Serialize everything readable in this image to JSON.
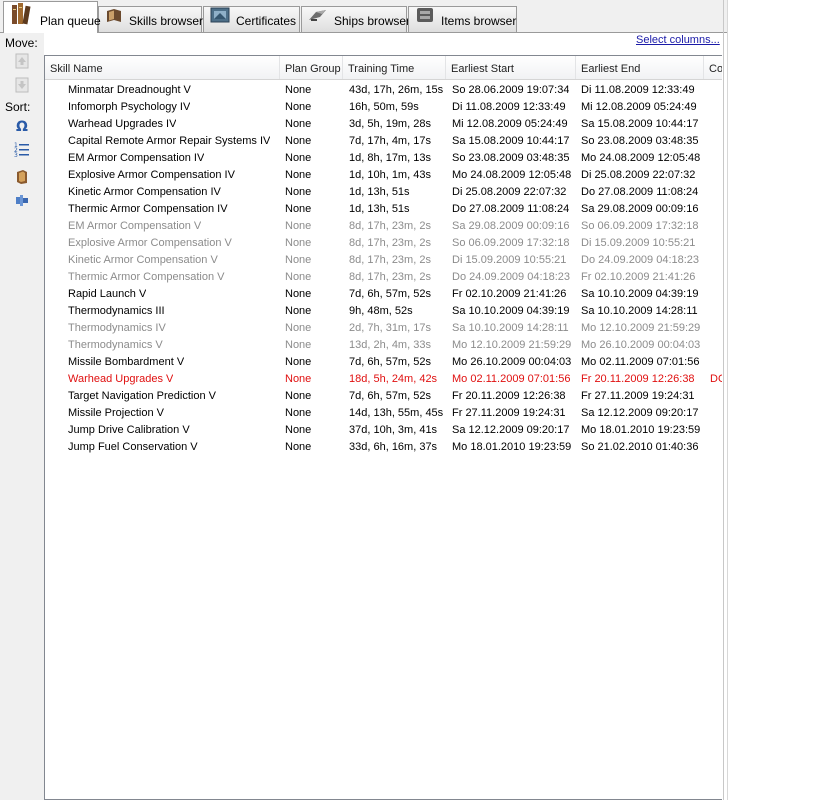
{
  "tabs": [
    {
      "label": "Plan queue",
      "icon": "books-icon",
      "active": true
    },
    {
      "label": "Skills browser",
      "icon": "book-icon",
      "active": false
    },
    {
      "label": "Certificates",
      "icon": "certificate-icon",
      "active": false
    },
    {
      "label": "Ships browser",
      "icon": "ship-icon",
      "active": false
    },
    {
      "label": "Items browser",
      "icon": "items-icon",
      "active": false
    }
  ],
  "sidebar": {
    "move_label": "Move:",
    "sort_label": "Sort:",
    "buttons": [
      "move-up-icon",
      "move-down-icon",
      "sort-alpha-icon",
      "sort-list-icon",
      "open-book-icon",
      "flag-icon"
    ]
  },
  "select_columns": "Select columns...",
  "columns": [
    "Skill Name",
    "Plan Group",
    "Training Time",
    "Earliest Start",
    "Earliest End",
    "Co"
  ],
  "rows": [
    {
      "name": "Minmatar Dreadnought V",
      "group": "None",
      "time": "43d, 17h, 26m, 15s",
      "start": "So 28.06.2009 19:07:34",
      "end": "Di 11.08.2009 12:33:49",
      "extra": "",
      "style": "normal"
    },
    {
      "name": "Infomorph Psychology IV",
      "group": "None",
      "time": "16h, 50m, 59s",
      "start": "Di 11.08.2009 12:33:49",
      "end": "Mi 12.08.2009 05:24:49",
      "extra": "",
      "style": "normal"
    },
    {
      "name": "Warhead Upgrades IV",
      "group": "None",
      "time": "3d, 5h, 19m, 28s",
      "start": "Mi 12.08.2009 05:24:49",
      "end": "Sa 15.08.2009 10:44:17",
      "extra": "",
      "style": "normal"
    },
    {
      "name": "Capital Remote Armor Repair Systems IV",
      "group": "None",
      "time": "7d, 17h, 4m, 17s",
      "start": "Sa 15.08.2009 10:44:17",
      "end": "So 23.08.2009 03:48:35",
      "extra": "",
      "style": "normal"
    },
    {
      "name": "EM Armor Compensation IV",
      "group": "None",
      "time": "1d, 8h, 17m, 13s",
      "start": "So 23.08.2009 03:48:35",
      "end": "Mo 24.08.2009 12:05:48",
      "extra": "",
      "style": "normal"
    },
    {
      "name": "Explosive Armor Compensation IV",
      "group": "None",
      "time": "1d, 10h, 1m, 43s",
      "start": "Mo 24.08.2009 12:05:48",
      "end": "Di 25.08.2009 22:07:32",
      "extra": "",
      "style": "normal"
    },
    {
      "name": "Kinetic Armor Compensation IV",
      "group": "None",
      "time": "1d, 13h, 51s",
      "start": "Di 25.08.2009 22:07:32",
      "end": "Do 27.08.2009 11:08:24",
      "extra": "",
      "style": "normal"
    },
    {
      "name": "Thermic Armor Compensation IV",
      "group": "None",
      "time": "1d, 13h, 51s",
      "start": "Do 27.08.2009 11:08:24",
      "end": "Sa 29.08.2009 00:09:16",
      "extra": "",
      "style": "normal"
    },
    {
      "name": "EM Armor Compensation V",
      "group": "None",
      "time": "8d, 17h, 23m, 2s",
      "start": "Sa 29.08.2009 00:09:16",
      "end": "So 06.09.2009 17:32:18",
      "extra": "",
      "style": "prereq"
    },
    {
      "name": "Explosive Armor Compensation V",
      "group": "None",
      "time": "8d, 17h, 23m, 2s",
      "start": "So 06.09.2009 17:32:18",
      "end": "Di 15.09.2009 10:55:21",
      "extra": "",
      "style": "prereq"
    },
    {
      "name": "Kinetic Armor Compensation V",
      "group": "None",
      "time": "8d, 17h, 23m, 2s",
      "start": "Di 15.09.2009 10:55:21",
      "end": "Do 24.09.2009 04:18:23",
      "extra": "",
      "style": "prereq"
    },
    {
      "name": "Thermic Armor Compensation V",
      "group": "None",
      "time": "8d, 17h, 23m, 2s",
      "start": "Do 24.09.2009 04:18:23",
      "end": "Fr 02.10.2009 21:41:26",
      "extra": "",
      "style": "prereq"
    },
    {
      "name": "Rapid Launch V",
      "group": "None",
      "time": "7d, 6h, 57m, 52s",
      "start": "Fr 02.10.2009 21:41:26",
      "end": "Sa 10.10.2009 04:39:19",
      "extra": "",
      "style": "normal"
    },
    {
      "name": "Thermodynamics III",
      "group": "None",
      "time": "9h, 48m, 52s",
      "start": "Sa 10.10.2009 04:39:19",
      "end": "Sa 10.10.2009 14:28:11",
      "extra": "",
      "style": "normal"
    },
    {
      "name": "Thermodynamics IV",
      "group": "None",
      "time": "2d, 7h, 31m, 17s",
      "start": "Sa 10.10.2009 14:28:11",
      "end": "Mo 12.10.2009 21:59:29",
      "extra": "",
      "style": "prereq"
    },
    {
      "name": "Thermodynamics V",
      "group": "None",
      "time": "13d, 2h, 4m, 33s",
      "start": "Mo 12.10.2009 21:59:29",
      "end": "Mo 26.10.2009 00:04:03",
      "extra": "",
      "style": "prereq"
    },
    {
      "name": "Missile Bombardment V",
      "group": "None",
      "time": "7d, 6h, 57m, 52s",
      "start": "Mo 26.10.2009 00:04:03",
      "end": "Mo 02.11.2009 07:01:56",
      "extra": "",
      "style": "normal"
    },
    {
      "name": "Warhead Upgrades V",
      "group": "None",
      "time": "18d, 5h, 24m, 42s",
      "start": "Mo 02.11.2009 07:01:56",
      "end": "Fr 20.11.2009 12:26:38",
      "extra": "DO",
      "style": "err"
    },
    {
      "name": "Target Navigation Prediction V",
      "group": "None",
      "time": "7d, 6h, 57m, 52s",
      "start": "Fr 20.11.2009 12:26:38",
      "end": "Fr 27.11.2009 19:24:31",
      "extra": "",
      "style": "normal"
    },
    {
      "name": "Missile Projection V",
      "group": "None",
      "time": "14d, 13h, 55m, 45s",
      "start": "Fr 27.11.2009 19:24:31",
      "end": "Sa 12.12.2009 09:20:17",
      "extra": "",
      "style": "normal"
    },
    {
      "name": "Jump Drive Calibration V",
      "group": "None",
      "time": "37d, 10h, 3m, 41s",
      "start": "Sa 12.12.2009 09:20:17",
      "end": "Mo 18.01.2010 19:23:59",
      "extra": "",
      "style": "normal"
    },
    {
      "name": "Jump Fuel Conservation V",
      "group": "None",
      "time": "33d, 6h, 16m, 37s",
      "start": "Mo 18.01.2010 19:23:59",
      "end": "So 21.02.2010 01:40:36",
      "extra": "",
      "style": "normal"
    }
  ],
  "colors": {
    "prereq": "#8c8c8c",
    "error": "#e01010",
    "link": "#1a1aa8"
  }
}
